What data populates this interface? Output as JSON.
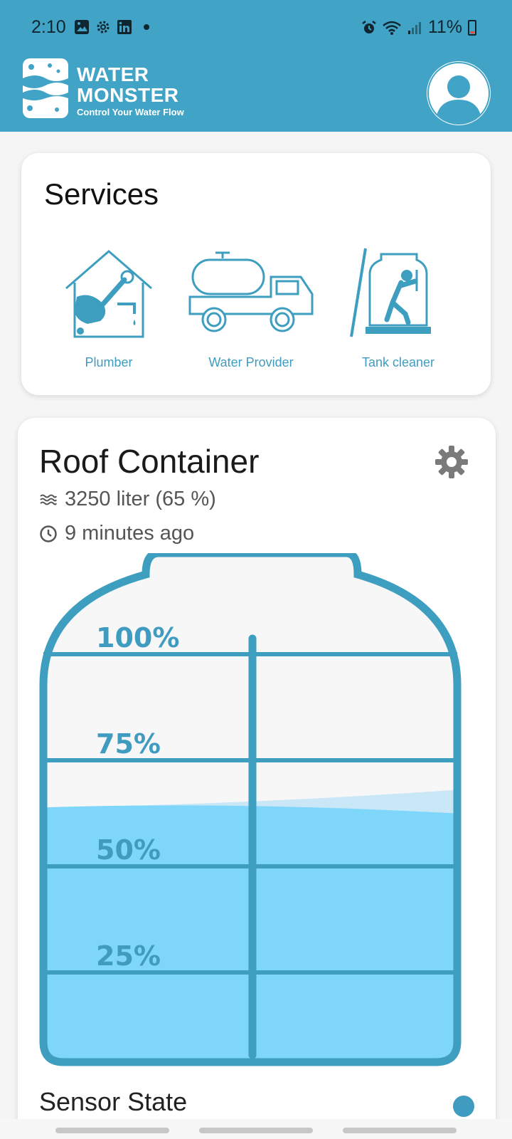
{
  "status_bar": {
    "time": "2:10",
    "battery": "11%",
    "left_icons": [
      "gallery-icon",
      "settings-icon",
      "linkedin-icon"
    ],
    "right_icons": [
      "alarm-icon",
      "wifi-icon",
      "signal-icon",
      "battery-icon"
    ]
  },
  "header": {
    "brand_line1": "WATER",
    "brand_line2": "MONSTER",
    "tagline": "Control Your Water Flow"
  },
  "services": {
    "title": "Services",
    "items": [
      {
        "label": "Plumber",
        "icon": "plumber-icon"
      },
      {
        "label": "Water Provider",
        "icon": "water-truck-icon"
      },
      {
        "label": "Tank cleaner",
        "icon": "tank-cleaner-icon"
      }
    ]
  },
  "container": {
    "title": "Roof Container",
    "volume_text": "3250 liter (65 %)",
    "updated_text": "9 minutes ago",
    "fill_level": 0.65,
    "markers": [
      "100%",
      "75%",
      "50%",
      "25%"
    ]
  },
  "sensor": {
    "title": "Sensor State"
  },
  "colors": {
    "primary": "#41a3c5",
    "tank_stroke": "#3d9ec0",
    "water": "#7fd6fb",
    "marker_text": "#3f9bbf"
  }
}
